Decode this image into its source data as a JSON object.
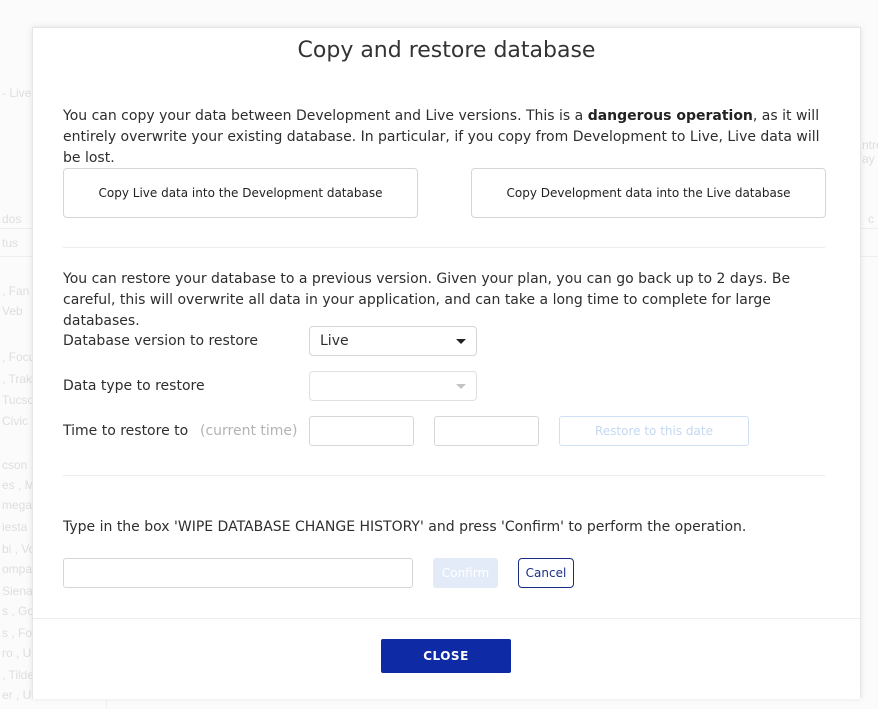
{
  "background": {
    "fragments": [
      "- Live",
      "dos",
      "tus",
      ", Fan",
      "Veb",
      ", Focu",
      ", Trak",
      "Tucso",
      "Civic",
      "cson ,",
      "es , Me",
      "megac",
      "iesta",
      "bi , Vo",
      "ompa",
      "Siena",
      "s , Gol",
      "s , Fo",
      "ro , U",
      ", Tilde",
      "er , Uni",
      "ntre",
      "ay",
      "c"
    ]
  },
  "modal": {
    "title": "Copy and restore database",
    "copy_section": {
      "text_before": "You can copy your data between Development and Live versions. This is a ",
      "text_bold": "dangerous operation",
      "text_after": ", as it will entirely overwrite your existing database. In particular, if you copy from Development to Live, Live data will be lost.",
      "copy_live_to_dev_label": "Copy Live data into the Development database",
      "copy_dev_to_live_label": "Copy Development data into the Live database"
    },
    "restore_section": {
      "text": "You can restore your database to a previous version. Given your plan, you can go back up to 2 days. Be careful, this will overwrite all data in your application, and can take a long time to complete for large databases.",
      "version_label": "Database version to restore",
      "version_value": "Live",
      "data_type_label": "Data type to restore",
      "data_type_value": "",
      "time_label": "Time to restore to",
      "time_hint": "(current time)",
      "date_value": "",
      "time_value": "",
      "restore_button_label": "Restore to this date"
    },
    "wipe_section": {
      "instruction": "Type in the box 'WIPE DATABASE CHANGE HISTORY' and press 'Confirm' to perform the operation.",
      "input_value": "",
      "confirm_label": "Confirm",
      "cancel_label": "Cancel"
    },
    "footer": {
      "close_label": "CLOSE"
    }
  },
  "colors": {
    "primary": "#0e2aa5",
    "cancel_border": "#1b2e86",
    "disabled_button": "#e3ebf9",
    "restore_disabled_text": "#c5d8f2"
  }
}
